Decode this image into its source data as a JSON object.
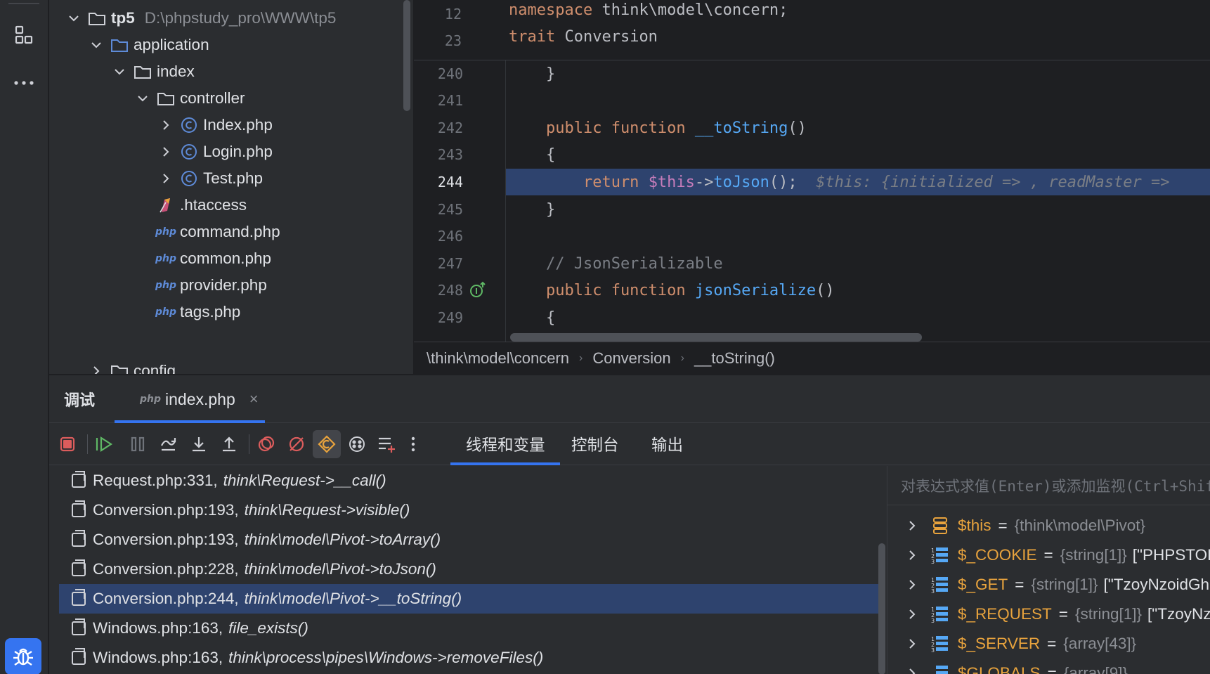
{
  "tree": {
    "root": {
      "name": "tp5",
      "path": "D:\\phpstudy_pro\\WWW\\tp5"
    },
    "items": [
      {
        "label": "application"
      },
      {
        "label": "index"
      },
      {
        "label": "controller"
      },
      {
        "label": "Index.php"
      },
      {
        "label": "Login.php"
      },
      {
        "label": "Test.php"
      },
      {
        "label": ".htaccess"
      },
      {
        "label": "command.php"
      },
      {
        "label": "common.php"
      },
      {
        "label": "provider.php"
      },
      {
        "label": "tags.php"
      },
      {
        "label": "config"
      }
    ],
    "php_icon_text": "php"
  },
  "editor": {
    "sticky": [
      {
        "num": "12",
        "t1": "namespace",
        "t2": " think\\model\\concern;"
      },
      {
        "num": "23",
        "t1": "trait",
        "t2": " Conversion"
      }
    ],
    "lines": {
      "l240": {
        "num": "240",
        "code": "    }"
      },
      "l241": {
        "num": "241",
        "code": ""
      },
      "l242": {
        "num": "242",
        "kw": "    public function ",
        "fn": "__toString",
        "rest": "()"
      },
      "l243": {
        "num": "243",
        "code": "    {"
      },
      "l244": {
        "num": "244",
        "kw": "        return ",
        "var": "$this",
        "op": "->",
        "fn": "toJson",
        "rest": "();",
        "hint": "  $this: {initialized => , readMaster => "
      },
      "l245": {
        "num": "245",
        "code": "    }"
      },
      "l246": {
        "num": "246",
        "code": ""
      },
      "l247": {
        "num": "247",
        "cm": "    // JsonSerializable"
      },
      "l248": {
        "num": "248",
        "kw": "    public function ",
        "fn": "jsonSerialize",
        "rest": "()"
      },
      "l249": {
        "num": "249",
        "code": "    {"
      }
    },
    "breadcrumb": [
      "\\think\\model\\concern",
      "Conversion",
      "__toString()"
    ]
  },
  "debug": {
    "title": "调试",
    "tab_label": "index.php",
    "tab_icon_text": "php",
    "view_tabs": [
      "线程和变量",
      "控制台",
      "输出"
    ],
    "frames": [
      {
        "loc": "Request.php:331,",
        "fn": "think\\Request->__call()"
      },
      {
        "loc": "Conversion.php:193,",
        "fn": "think\\Request->visible()"
      },
      {
        "loc": "Conversion.php:193,",
        "fn": "think\\model\\Pivot->toArray()"
      },
      {
        "loc": "Conversion.php:228,",
        "fn": "think\\model\\Pivot->toJson()"
      },
      {
        "loc": "Conversion.php:244,",
        "fn": "think\\model\\Pivot->__toString()"
      },
      {
        "loc": "Windows.php:163,",
        "fn": "file_exists()"
      },
      {
        "loc": "Windows.php:163,",
        "fn": "think\\process\\pipes\\Windows->removeFiles()"
      }
    ],
    "eval_placeholder": "对表达式求值(Enter)或添加监视(Ctrl+Shift+Enter)",
    "vars": [
      {
        "name": "$this",
        "eq": "=",
        "type": "{think\\model\\Pivot}",
        "value": ""
      },
      {
        "name": "$_COOKIE",
        "eq": "=",
        "type": "{string[1]}",
        "value": "[\"PHPSTORM"
      },
      {
        "name": "$_GET",
        "eq": "=",
        "type": "{string[1]}",
        "value": "[\"TzoyNzoidGhp"
      },
      {
        "name": "$_REQUEST",
        "eq": "=",
        "type": "{string[1]}",
        "value": "[\"TzoyNzo"
      },
      {
        "name": "$_SERVER",
        "eq": "=",
        "type": "{array[43]}",
        "value": ""
      },
      {
        "name": "$GLOBALS",
        "eq": "=",
        "type": "{array[9]}",
        "value": ""
      }
    ]
  },
  "colors": {
    "accent": "#3574f0",
    "selection": "#2e436e",
    "stop": "#db5c5c",
    "resume": "#5fb865"
  }
}
